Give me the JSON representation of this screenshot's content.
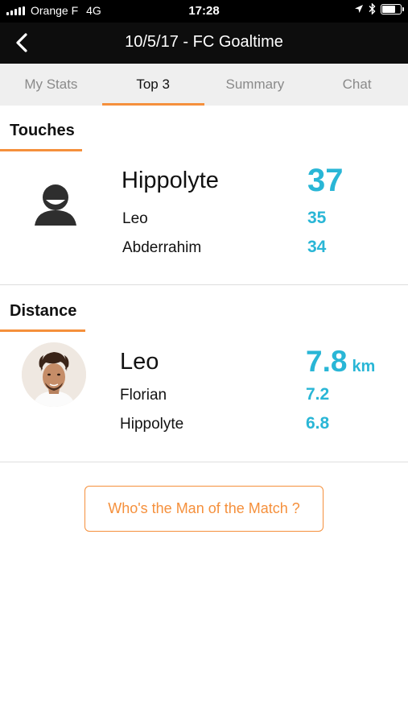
{
  "status_bar": {
    "carrier": "Orange F",
    "network": "4G",
    "time": "17:28",
    "battery_level": 0.75
  },
  "nav": {
    "title": "10/5/17 - FC Goaltime",
    "back_icon": "chevron-left-icon"
  },
  "tabs": [
    {
      "label": "My Stats",
      "active": false
    },
    {
      "label": "Top 3",
      "active": true
    },
    {
      "label": "Summary",
      "active": false
    },
    {
      "label": "Chat",
      "active": false
    }
  ],
  "touches": {
    "title": "Touches",
    "leader": {
      "name": "Hippolyte",
      "value": "37"
    },
    "second": {
      "name": "Leo",
      "value": "35"
    },
    "third": {
      "name": "Abderrahim",
      "value": "34"
    }
  },
  "distance": {
    "title": "Distance",
    "leader": {
      "name": "Leo",
      "value": "7.8",
      "unit": "km"
    },
    "second": {
      "name": "Florian",
      "value": "7.2"
    },
    "third": {
      "name": "Hippolyte",
      "value": "6.8"
    }
  },
  "motm_button": {
    "label": "Who's the Man of the Match ?"
  },
  "colors": {
    "accent_orange": "#f5903c",
    "value_blue": "#29b6d6",
    "nav_background": "#0d0d0d"
  }
}
